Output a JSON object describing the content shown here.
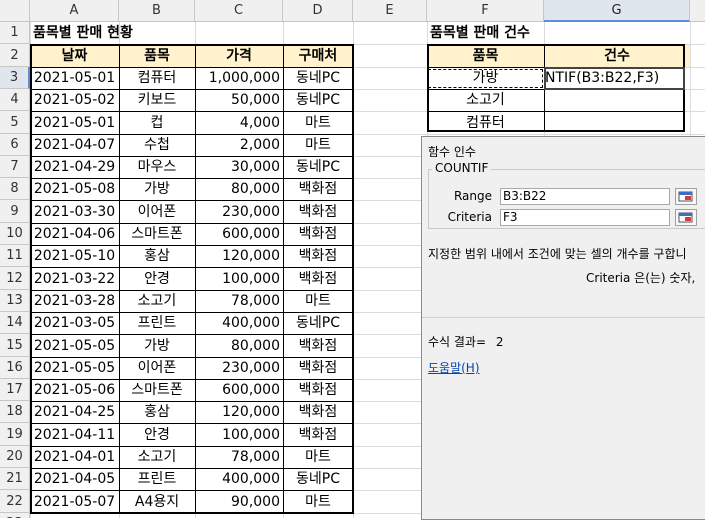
{
  "columns": [
    "A",
    "B",
    "C",
    "D",
    "E",
    "F",
    "G"
  ],
  "row_numbers": [
    "1",
    "2",
    "3",
    "4",
    "5",
    "6",
    "7",
    "8",
    "9",
    "10",
    "11",
    "12",
    "13",
    "14",
    "15",
    "16",
    "17",
    "18",
    "19",
    "20",
    "21",
    "22",
    "23"
  ],
  "title_left": "품목별 판매 현황",
  "title_right": "품목별 판매 건수",
  "headers_left": [
    "날짜",
    "품목",
    "가격",
    "구매처"
  ],
  "headers_right": [
    "품목",
    "건수"
  ],
  "rows_left": [
    [
      "2021-05-01",
      "컴퓨터",
      "1,000,000",
      "동네PC"
    ],
    [
      "2021-05-02",
      "키보드",
      "50,000",
      "동네PC"
    ],
    [
      "2021-05-01",
      "컵",
      "4,000",
      "마트"
    ],
    [
      "2021-04-07",
      "수첩",
      "2,000",
      "마트"
    ],
    [
      "2021-04-29",
      "마우스",
      "30,000",
      "동네PC"
    ],
    [
      "2021-05-08",
      "가방",
      "80,000",
      "백화점"
    ],
    [
      "2021-03-30",
      "이어폰",
      "230,000",
      "백화점"
    ],
    [
      "2021-04-06",
      "스마트폰",
      "600,000",
      "백화점"
    ],
    [
      "2021-05-10",
      "홍삼",
      "120,000",
      "백화점"
    ],
    [
      "2021-03-22",
      "안경",
      "100,000",
      "백화점"
    ],
    [
      "2021-03-28",
      "소고기",
      "78,000",
      "마트"
    ],
    [
      "2021-03-05",
      "프린트",
      "400,000",
      "동네PC"
    ],
    [
      "2021-05-05",
      "가방",
      "80,000",
      "백화점"
    ],
    [
      "2021-05-05",
      "이어폰",
      "230,000",
      "백화점"
    ],
    [
      "2021-05-06",
      "스마트폰",
      "600,000",
      "백화점"
    ],
    [
      "2021-04-25",
      "홍삼",
      "120,000",
      "백화점"
    ],
    [
      "2021-04-11",
      "안경",
      "100,000",
      "백화점"
    ],
    [
      "2021-04-01",
      "소고기",
      "78,000",
      "마트"
    ],
    [
      "2021-04-05",
      "프린트",
      "400,000",
      "동네PC"
    ],
    [
      "2021-05-07",
      "A4용지",
      "90,000",
      "마트"
    ]
  ],
  "rows_right": [
    [
      "가방",
      "NTIF(B3:B22,F3)"
    ],
    [
      "소고기",
      ""
    ],
    [
      "컴퓨터",
      ""
    ]
  ],
  "dialog": {
    "title": "함수 인수",
    "function_name": "COUNTIF",
    "range_label": "Range",
    "range_value": "B3:B22",
    "criteria_label": "Criteria",
    "criteria_value": "F3",
    "description": "지정한 범위 내에서 조건에 맞는 셀의 개수를 구합니",
    "arg_description": "Criteria  은(는) 숫자,",
    "result_label": "수식 결과=",
    "result_value": "2",
    "help_link": "도움말(H)"
  },
  "colors": {
    "header_fill": "#fff2cc",
    "selected_header": "#dfe6ee",
    "accent": "#5b8fd6",
    "link": "#0645ad"
  }
}
